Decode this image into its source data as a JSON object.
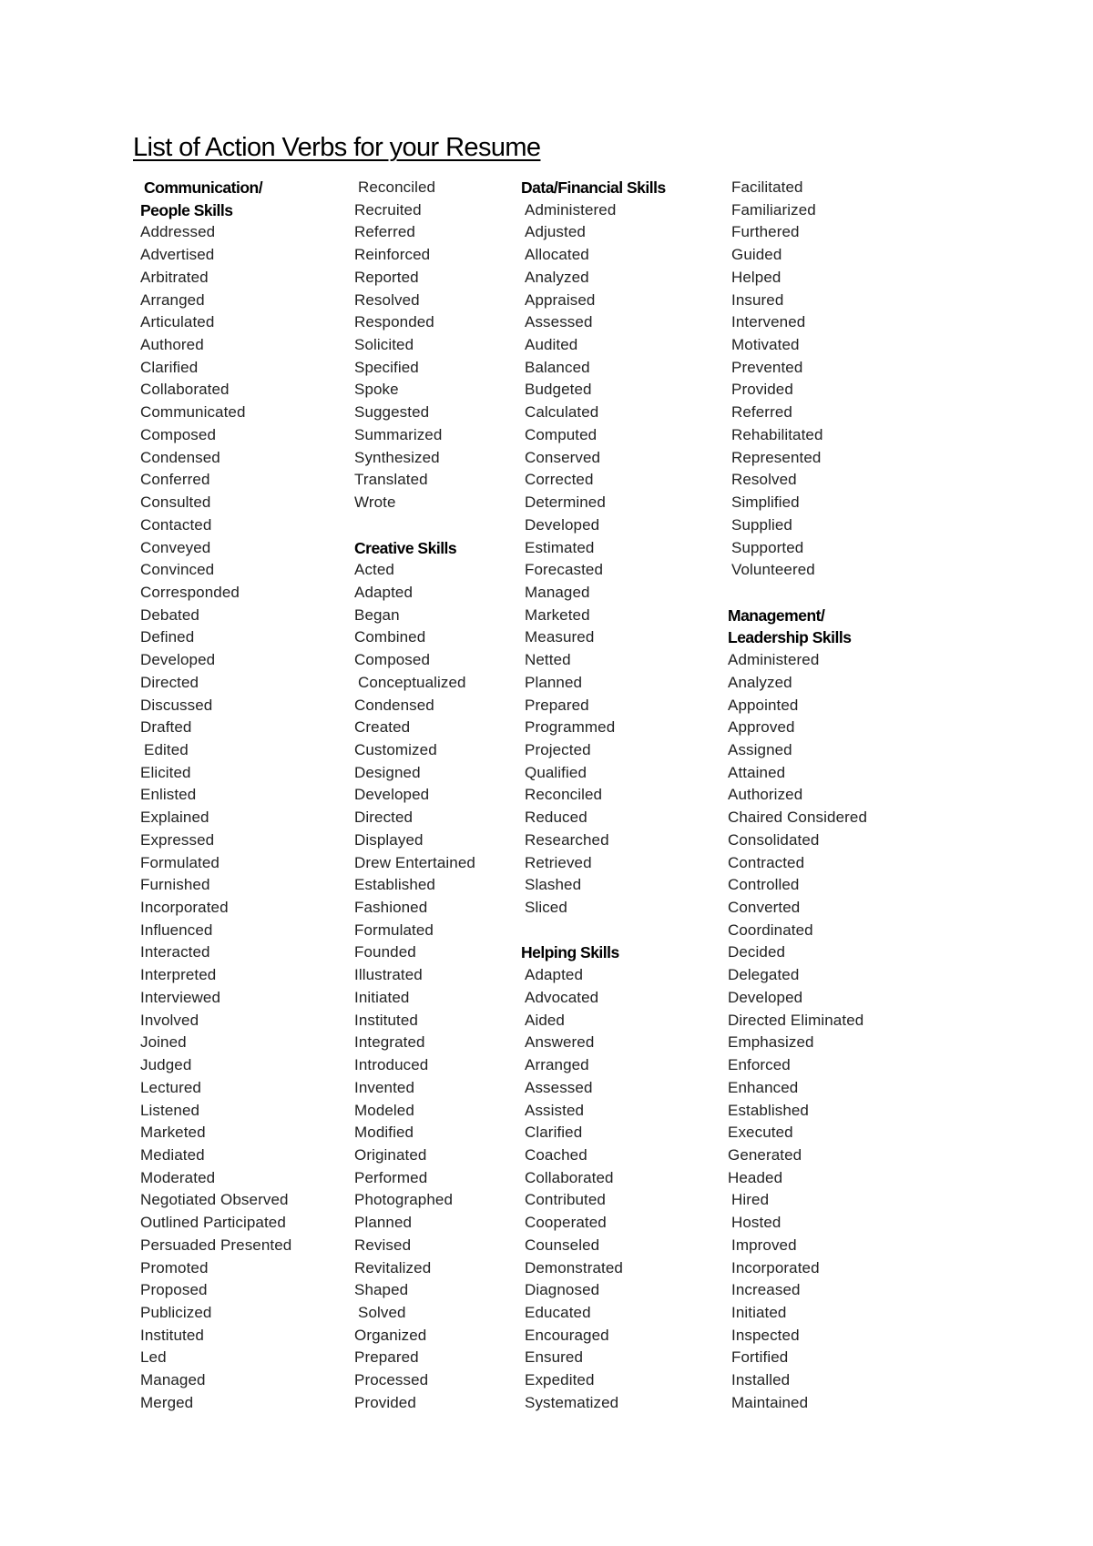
{
  "document": {
    "title": "List of Action Verbs for your Resume"
  },
  "columns": [
    {
      "entries": [
        {
          "row": 0,
          "text": "Communication/",
          "heading": true,
          "indent": true
        },
        {
          "row": 1,
          "text": "People Skills",
          "heading": true
        },
        {
          "row": 2,
          "text": "Addressed"
        },
        {
          "row": 3,
          "text": "Advertised"
        },
        {
          "row": 4,
          "text": "Arbitrated"
        },
        {
          "row": 5,
          "text": "Arranged"
        },
        {
          "row": 6,
          "text": "Articulated"
        },
        {
          "row": 7,
          "text": "Authored"
        },
        {
          "row": 8,
          "text": "Clarified"
        },
        {
          "row": 9,
          "text": "Collaborated"
        },
        {
          "row": 10,
          "text": "Communicated"
        },
        {
          "row": 11,
          "text": "Composed"
        },
        {
          "row": 12,
          "text": "Condensed"
        },
        {
          "row": 13,
          "text": "Conferred"
        },
        {
          "row": 14,
          "text": "Consulted"
        },
        {
          "row": 15,
          "text": "Contacted"
        },
        {
          "row": 16,
          "text": "Conveyed"
        },
        {
          "row": 17,
          "text": "Convinced"
        },
        {
          "row": 18,
          "text": "Corresponded"
        },
        {
          "row": 19,
          "text": "Debated"
        },
        {
          "row": 20,
          "text": "Defined"
        },
        {
          "row": 21,
          "text": "Developed"
        },
        {
          "row": 22,
          "text": "Directed"
        },
        {
          "row": 23,
          "text": "Discussed"
        },
        {
          "row": 24,
          "text": "Drafted"
        },
        {
          "row": 25,
          "text": "Edited",
          "indent": true
        },
        {
          "row": 26,
          "text": "Elicited"
        },
        {
          "row": 27,
          "text": "Enlisted"
        },
        {
          "row": 28,
          "text": "Explained"
        },
        {
          "row": 29,
          "text": "Expressed"
        },
        {
          "row": 30,
          "text": "Formulated"
        },
        {
          "row": 31,
          "text": "Furnished"
        },
        {
          "row": 32,
          "text": "Incorporated"
        },
        {
          "row": 33,
          "text": "Influenced"
        },
        {
          "row": 34,
          "text": "Interacted"
        },
        {
          "row": 35,
          "text": "Interpreted"
        },
        {
          "row": 36,
          "text": "Interviewed"
        },
        {
          "row": 37,
          "text": "Involved"
        },
        {
          "row": 38,
          "text": "Joined"
        },
        {
          "row": 39,
          "text": "Judged"
        },
        {
          "row": 40,
          "text": "Lectured"
        },
        {
          "row": 41,
          "text": "Listened"
        },
        {
          "row": 42,
          "text": "Marketed"
        },
        {
          "row": 43,
          "text": "Mediated"
        },
        {
          "row": 44,
          "text": "Moderated"
        },
        {
          "row": 45,
          "text": "Negotiated Observed"
        },
        {
          "row": 46,
          "text": "Outlined Participated"
        },
        {
          "row": 47,
          "text": "Persuaded Presented"
        },
        {
          "row": 48,
          "text": "Promoted"
        },
        {
          "row": 49,
          "text": "Proposed"
        },
        {
          "row": 50,
          "text": "Publicized"
        },
        {
          "row": 51,
          "text": "Instituted"
        },
        {
          "row": 52,
          "text": "Led"
        },
        {
          "row": 53,
          "text": "Managed"
        },
        {
          "row": 54,
          "text": "Merged"
        }
      ]
    },
    {
      "entries": [
        {
          "row": 0,
          "text": "Reconciled",
          "indent": true
        },
        {
          "row": 1,
          "text": "Recruited"
        },
        {
          "row": 2,
          "text": "Referred"
        },
        {
          "row": 3,
          "text": "Reinforced"
        },
        {
          "row": 4,
          "text": "Reported"
        },
        {
          "row": 5,
          "text": "Resolved"
        },
        {
          "row": 6,
          "text": "Responded"
        },
        {
          "row": 7,
          "text": "Solicited"
        },
        {
          "row": 8,
          "text": "Specified"
        },
        {
          "row": 9,
          "text": "Spoke"
        },
        {
          "row": 10,
          "text": "Suggested"
        },
        {
          "row": 11,
          "text": "Summarized"
        },
        {
          "row": 12,
          "text": "Synthesized"
        },
        {
          "row": 13,
          "text": "Translated"
        },
        {
          "row": 14,
          "text": "Wrote"
        },
        {
          "row": 16,
          "text": "Creative Skills",
          "heading": true
        },
        {
          "row": 17,
          "text": "Acted"
        },
        {
          "row": 18,
          "text": "Adapted"
        },
        {
          "row": 19,
          "text": "Began"
        },
        {
          "row": 20,
          "text": "Combined"
        },
        {
          "row": 21,
          "text": "Composed"
        },
        {
          "row": 22,
          "text": "Conceptualized",
          "indent": true
        },
        {
          "row": 23,
          "text": "Condensed"
        },
        {
          "row": 24,
          "text": "Created"
        },
        {
          "row": 25,
          "text": "Customized"
        },
        {
          "row": 26,
          "text": "Designed"
        },
        {
          "row": 27,
          "text": "Developed"
        },
        {
          "row": 28,
          "text": "Directed"
        },
        {
          "row": 29,
          "text": "Displayed"
        },
        {
          "row": 30,
          "text": "Drew Entertained"
        },
        {
          "row": 31,
          "text": "Established"
        },
        {
          "row": 32,
          "text": "Fashioned"
        },
        {
          "row": 33,
          "text": "Formulated"
        },
        {
          "row": 34,
          "text": "Founded"
        },
        {
          "row": 35,
          "text": "Illustrated"
        },
        {
          "row": 36,
          "text": "Initiated"
        },
        {
          "row": 37,
          "text": "Instituted"
        },
        {
          "row": 38,
          "text": "Integrated"
        },
        {
          "row": 39,
          "text": "Introduced"
        },
        {
          "row": 40,
          "text": "Invented"
        },
        {
          "row": 41,
          "text": "Modeled"
        },
        {
          "row": 42,
          "text": "Modified"
        },
        {
          "row": 43,
          "text": "Originated"
        },
        {
          "row": 44,
          "text": "Performed"
        },
        {
          "row": 45,
          "text": "Photographed"
        },
        {
          "row": 46,
          "text": "Planned"
        },
        {
          "row": 47,
          "text": "Revised"
        },
        {
          "row": 48,
          "text": "Revitalized"
        },
        {
          "row": 49,
          "text": "Shaped"
        },
        {
          "row": 50,
          "text": "Solved",
          "indent": true
        },
        {
          "row": 51,
          "text": "Organized"
        },
        {
          "row": 52,
          "text": "Prepared"
        },
        {
          "row": 53,
          "text": "Processed"
        },
        {
          "row": 54,
          "text": "Provided"
        }
      ]
    },
    {
      "entries": [
        {
          "row": 0,
          "text": "Data/Financial Skills",
          "heading": true
        },
        {
          "row": 1,
          "text": "Administered",
          "indent": true
        },
        {
          "row": 2,
          "text": "Adjusted",
          "indent": true
        },
        {
          "row": 3,
          "text": "Allocated",
          "indent": true
        },
        {
          "row": 4,
          "text": "Analyzed",
          "indent": true
        },
        {
          "row": 5,
          "text": "Appraised",
          "indent": true
        },
        {
          "row": 6,
          "text": "Assessed",
          "indent": true
        },
        {
          "row": 7,
          "text": "Audited",
          "indent": true
        },
        {
          "row": 8,
          "text": "Balanced",
          "indent": true
        },
        {
          "row": 9,
          "text": "Budgeted",
          "indent": true
        },
        {
          "row": 10,
          "text": "Calculated",
          "indent": true
        },
        {
          "row": 11,
          "text": "Computed",
          "indent": true
        },
        {
          "row": 12,
          "text": "Conserved",
          "indent": true
        },
        {
          "row": 13,
          "text": "Corrected",
          "indent": true
        },
        {
          "row": 14,
          "text": "Determined",
          "indent": true
        },
        {
          "row": 15,
          "text": "Developed",
          "indent": true
        },
        {
          "row": 16,
          "text": "Estimated",
          "indent": true
        },
        {
          "row": 17,
          "text": "Forecasted",
          "indent": true
        },
        {
          "row": 18,
          "text": "Managed",
          "indent": true
        },
        {
          "row": 19,
          "text": "Marketed",
          "indent": true
        },
        {
          "row": 20,
          "text": "Measured",
          "indent": true
        },
        {
          "row": 21,
          "text": "Netted",
          "indent": true
        },
        {
          "row": 22,
          "text": "Planned",
          "indent": true
        },
        {
          "row": 23,
          "text": "Prepared",
          "indent": true
        },
        {
          "row": 24,
          "text": "Programmed",
          "indent": true
        },
        {
          "row": 25,
          "text": "Projected",
          "indent": true
        },
        {
          "row": 26,
          "text": "Qualified",
          "indent": true
        },
        {
          "row": 27,
          "text": "Reconciled",
          "indent": true
        },
        {
          "row": 28,
          "text": "Reduced",
          "indent": true
        },
        {
          "row": 29,
          "text": "Researched",
          "indent": true
        },
        {
          "row": 30,
          "text": "Retrieved",
          "indent": true
        },
        {
          "row": 31,
          "text": "Slashed",
          "indent": true
        },
        {
          "row": 32,
          "text": "Sliced",
          "indent": true
        },
        {
          "row": 34,
          "text": "Helping Skills",
          "heading": true
        },
        {
          "row": 35,
          "text": "Adapted",
          "indent": true
        },
        {
          "row": 36,
          "text": "Advocated",
          "indent": true
        },
        {
          "row": 37,
          "text": "Aided",
          "indent": true
        },
        {
          "row": 38,
          "text": "Answered",
          "indent": true
        },
        {
          "row": 39,
          "text": "Arranged",
          "indent": true
        },
        {
          "row": 40,
          "text": "Assessed",
          "indent": true
        },
        {
          "row": 41,
          "text": "Assisted",
          "indent": true
        },
        {
          "row": 42,
          "text": "Clarified",
          "indent": true
        },
        {
          "row": 43,
          "text": "Coached",
          "indent": true
        },
        {
          "row": 44,
          "text": "Collaborated",
          "indent": true
        },
        {
          "row": 45,
          "text": "Contributed",
          "indent": true
        },
        {
          "row": 46,
          "text": "Cooperated",
          "indent": true
        },
        {
          "row": 47,
          "text": "Counseled",
          "indent": true
        },
        {
          "row": 48,
          "text": "Demonstrated",
          "indent": true
        },
        {
          "row": 49,
          "text": "Diagnosed",
          "indent": true
        },
        {
          "row": 50,
          "text": "Educated",
          "indent": true
        },
        {
          "row": 51,
          "text": "Encouraged",
          "indent": true
        },
        {
          "row": 52,
          "text": "Ensured",
          "indent": true
        },
        {
          "row": 53,
          "text": "Expedited",
          "indent": true
        },
        {
          "row": 54,
          "text": "Systematized",
          "indent": true
        }
      ]
    },
    {
      "entries": [
        {
          "row": 0,
          "text": "Facilitated",
          "indent": true
        },
        {
          "row": 1,
          "text": "Familiarized",
          "indent": true
        },
        {
          "row": 2,
          "text": "Furthered",
          "indent": true
        },
        {
          "row": 3,
          "text": "Guided",
          "indent": true
        },
        {
          "row": 4,
          "text": "Helped",
          "indent": true
        },
        {
          "row": 5,
          "text": "Insured",
          "indent": true
        },
        {
          "row": 6,
          "text": "Intervened",
          "indent": true
        },
        {
          "row": 7,
          "text": "Motivated",
          "indent": true
        },
        {
          "row": 8,
          "text": "Prevented",
          "indent": true
        },
        {
          "row": 9,
          "text": "Provided",
          "indent": true
        },
        {
          "row": 10,
          "text": "Referred",
          "indent": true
        },
        {
          "row": 11,
          "text": "Rehabilitated",
          "indent": true
        },
        {
          "row": 12,
          "text": "Represented",
          "indent": true
        },
        {
          "row": 13,
          "text": "Resolved",
          "indent": true
        },
        {
          "row": 14,
          "text": "Simplified",
          "indent": true
        },
        {
          "row": 15,
          "text": "Supplied",
          "indent": true
        },
        {
          "row": 16,
          "text": "Supported",
          "indent": true
        },
        {
          "row": 17,
          "text": "Volunteered",
          "indent": true
        },
        {
          "row": 19,
          "text": "Management/",
          "heading": true
        },
        {
          "row": 20,
          "text": "Leadership Skills",
          "heading": true
        },
        {
          "row": 21,
          "text": "Administered"
        },
        {
          "row": 22,
          "text": "Analyzed"
        },
        {
          "row": 23,
          "text": "Appointed"
        },
        {
          "row": 24,
          "text": "Approved"
        },
        {
          "row": 25,
          "text": "Assigned"
        },
        {
          "row": 26,
          "text": "Attained"
        },
        {
          "row": 27,
          "text": "Authorized"
        },
        {
          "row": 28,
          "text": "Chaired Considered"
        },
        {
          "row": 29,
          "text": "Consolidated"
        },
        {
          "row": 30,
          "text": "Contracted"
        },
        {
          "row": 31,
          "text": "Controlled"
        },
        {
          "row": 32,
          "text": "Converted"
        },
        {
          "row": 33,
          "text": "Coordinated"
        },
        {
          "row": 34,
          "text": "Decided"
        },
        {
          "row": 35,
          "text": "Delegated"
        },
        {
          "row": 36,
          "text": "Developed"
        },
        {
          "row": 37,
          "text": "Directed Eliminated"
        },
        {
          "row": 38,
          "text": "Emphasized"
        },
        {
          "row": 39,
          "text": "Enforced"
        },
        {
          "row": 40,
          "text": "Enhanced"
        },
        {
          "row": 41,
          "text": "Established"
        },
        {
          "row": 42,
          "text": "Executed"
        },
        {
          "row": 43,
          "text": "Generated"
        },
        {
          "row": 44,
          "text": "Headed"
        },
        {
          "row": 45,
          "text": "Hired",
          "indent": true
        },
        {
          "row": 46,
          "text": "Hosted",
          "indent": true
        },
        {
          "row": 47,
          "text": "Improved",
          "indent": true
        },
        {
          "row": 48,
          "text": "Incorporated",
          "indent": true
        },
        {
          "row": 49,
          "text": "Increased",
          "indent": true
        },
        {
          "row": 50,
          "text": "Initiated",
          "indent": true
        },
        {
          "row": 51,
          "text": "Inspected",
          "indent": true
        },
        {
          "row": 52,
          "text": "Fortified",
          "indent": true
        },
        {
          "row": 53,
          "text": "Installed",
          "indent": true
        },
        {
          "row": 54,
          "text": "Maintained",
          "indent": true
        }
      ]
    }
  ]
}
